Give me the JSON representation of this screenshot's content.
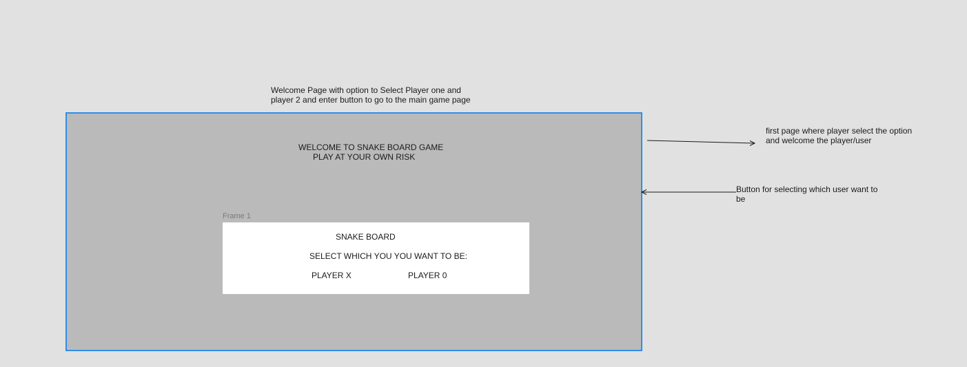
{
  "annotations": {
    "top_note": "Welcome Page with option to Select Player one and\nplayer 2 and enter button to go to the main game page",
    "right_note_1": "first page where player select the option\nand welcome the player/user",
    "right_note_2": "Button for selecting which  user want to\nbe"
  },
  "artboard": {
    "welcome_line1": "WELCOME TO SNAKE BOARD GAME",
    "welcome_line2": "PLAY AT YOUR OWN RISK"
  },
  "frame": {
    "label": "Frame 1",
    "title": "SNAKE BOARD",
    "prompt": "SELECT WHICH YOU YOU WANT TO BE:",
    "player_x_label": "PLAYER X",
    "player_0_label": "PLAYER 0"
  },
  "colors": {
    "canvas": "#e1e1e1",
    "artboard_fill": "#bababa",
    "selection_border": "#2f8ee8",
    "frame_fill": "#ffffff"
  }
}
